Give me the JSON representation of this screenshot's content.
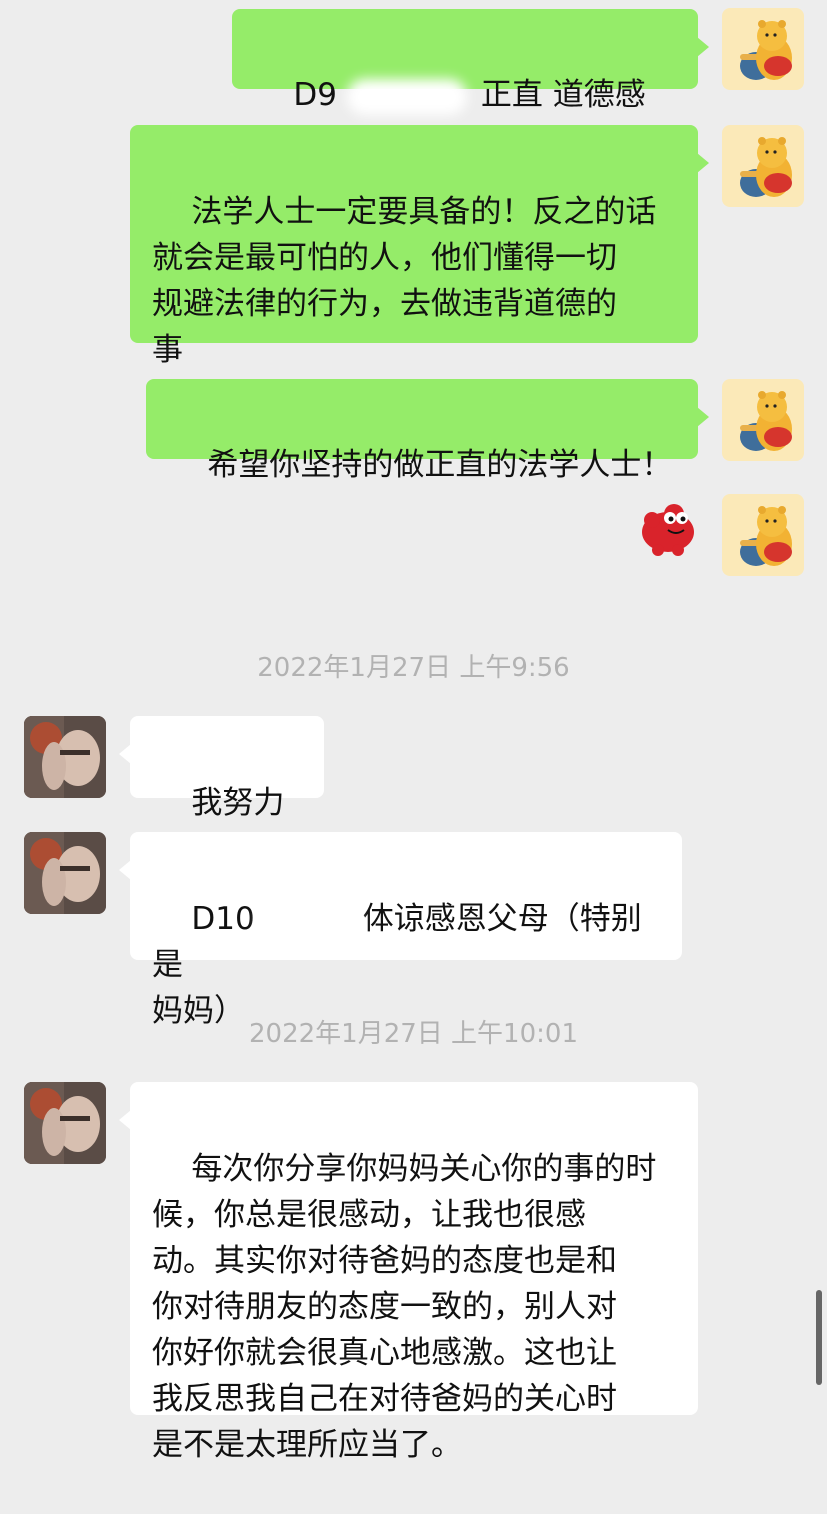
{
  "messages": [
    {
      "side": "mine",
      "text_before": "D9 ",
      "text_after": "正直 道德感强"
    },
    {
      "side": "mine",
      "text": "法学人士一定要具备的！反之的话\n就会是最可怕的人，他们懂得一切\n规避法律的行为，去做违背道德的\n事"
    },
    {
      "side": "mine",
      "text": "希望你坚持的做正直的法学人士！"
    },
    {
      "side": "mine",
      "sticker": "red-blob-sticker"
    },
    {
      "timestamp": "2022年1月27日 上午9:56"
    },
    {
      "side": "theirs",
      "text": "我努力",
      "emoji": "✊"
    },
    {
      "side": "theirs",
      "text_before": "D10",
      "text_after": "体谅感恩父母（特别是\n妈妈）"
    },
    {
      "timestamp": "2022年1月27日 上午10:01"
    },
    {
      "side": "theirs",
      "text": "每次你分享你妈妈关心你的事的时\n候，你总是很感动，让我也很感\n动。其实你对待爸妈的态度也是和\n你对待朋友的态度一致的，别人对\n你好你就会很真心地感激。这也让\n我反思我自己在对待爸妈的关心时\n是不是太理所应当了。"
    }
  ],
  "colors": {
    "background": "#EDEDED",
    "mine_bubble": "#95EC69",
    "theirs_bubble": "#FFFFFF",
    "timestamp": "#B2B2B2"
  },
  "icons": {
    "my_avatar": "winnie-the-pooh-avatar",
    "their_avatar": "person-photo-avatar"
  }
}
